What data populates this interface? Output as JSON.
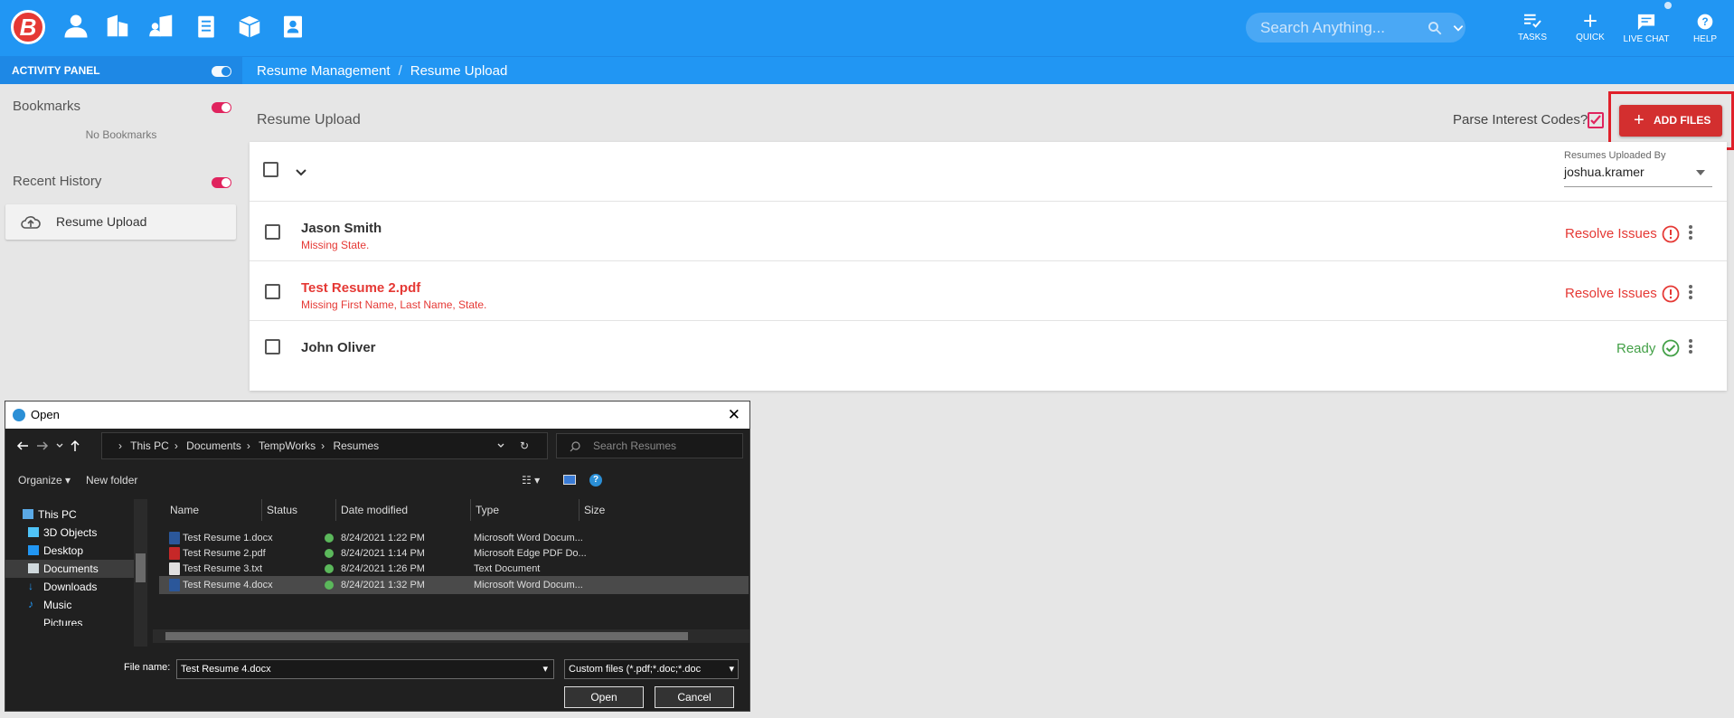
{
  "app": {
    "logo_letter": "B",
    "accent": "#2196f3",
    "danger": "#e53935",
    "success": "#43a047"
  },
  "nav_icons": [
    "person-icon",
    "building-icon",
    "people-building-icon",
    "clipboard-icon",
    "box-icon",
    "badge-icon"
  ],
  "search": {
    "placeholder": "Search Anything..."
  },
  "top_buttons": [
    {
      "label": "TASKS",
      "icon": "tasks-icon"
    },
    {
      "label": "QUICK",
      "icon": "plus-icon"
    },
    {
      "label": "LIVE CHAT",
      "icon": "chat-icon"
    },
    {
      "label": "HELP",
      "icon": "help-icon"
    }
  ],
  "subbar": {
    "activity_panel": "ACTIVITY PANEL",
    "breadcrumb": [
      "Resume Management",
      "Resume Upload"
    ],
    "separator": "/"
  },
  "sidebar": {
    "bookmarks_title": "Bookmarks",
    "bookmarks_empty": "No Bookmarks",
    "history_title": "Recent History",
    "history_item": "Resume Upload"
  },
  "main": {
    "title": "Resume Upload",
    "parse_label": "Parse Interest Codes?",
    "parse_checked": true,
    "add_files": "ADD FILES",
    "uploaded_by_label": "Resumes Uploaded By",
    "uploaded_by_value": "joshua.kramer",
    "rows": [
      {
        "name": "Jason Smith",
        "error": "Missing State.",
        "status": "Resolve Issues",
        "status_type": "error",
        "name_red": false
      },
      {
        "name": "Test Resume 2.pdf",
        "error": "Missing First Name, Last Name, State.",
        "status": "Resolve Issues",
        "status_type": "error",
        "name_red": true
      },
      {
        "name": "John Oliver",
        "error": "",
        "status": "Ready",
        "status_type": "ok",
        "name_red": false
      }
    ]
  },
  "dialog": {
    "title": "Open",
    "path": [
      "This PC",
      "Documents",
      "TempWorks",
      "Resumes"
    ],
    "search_placeholder": "Search Resumes",
    "organize": "Organize",
    "new_folder": "New folder",
    "columns": [
      "Name",
      "Status",
      "Date modified",
      "Type",
      "Size"
    ],
    "tree": [
      "This PC",
      "3D Objects",
      "Desktop",
      "Documents",
      "Downloads",
      "Music",
      "Pictures"
    ],
    "files": [
      {
        "name": "Test Resume 1.docx",
        "date": "8/24/2021 1:22 PM",
        "type": "Microsoft Word Docum...",
        "icon": "word-doc-icon"
      },
      {
        "name": "Test Resume 2.pdf",
        "date": "8/24/2021 1:14 PM",
        "type": "Microsoft Edge PDF Do...",
        "icon": "pdf-icon"
      },
      {
        "name": "Test Resume 3.txt",
        "date": "8/24/2021 1:26 PM",
        "type": "Text Document",
        "icon": "text-file-icon"
      },
      {
        "name": "Test Resume 4.docx",
        "date": "8/24/2021 1:32 PM",
        "type": "Microsoft Word Docum...",
        "icon": "word-doc-icon"
      }
    ],
    "file_name_label": "File name:",
    "file_name_value": "Test Resume 4.docx",
    "filter": "Custom files (*.pdf;*.doc;*.doc",
    "open": "Open",
    "cancel": "Cancel"
  }
}
